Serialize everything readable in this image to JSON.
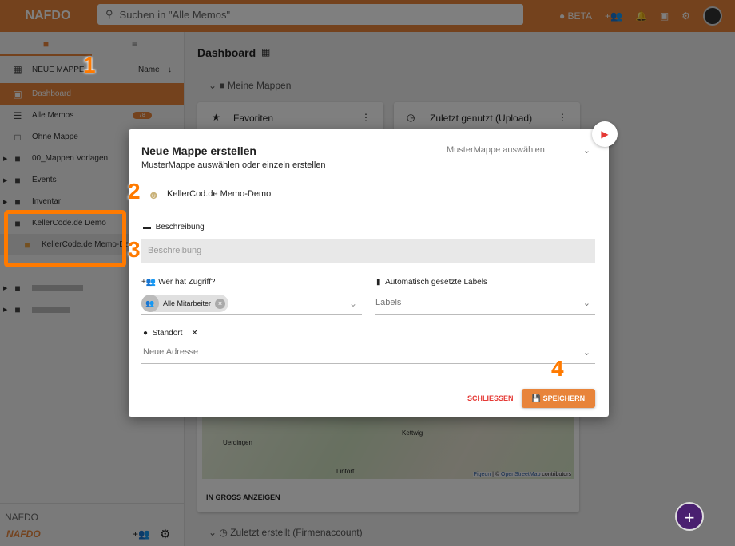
{
  "header": {
    "logo": "NAFDO",
    "search_placeholder": "Suchen in \"Alle Memos\"",
    "beta": "BETA"
  },
  "sidebar": {
    "new_folder": "NEUE MAPPE",
    "sort": "Name",
    "items": [
      {
        "label": "Dashboard"
      },
      {
        "label": "Alle Memos",
        "badge": "78"
      },
      {
        "label": "Ohne Mappe"
      },
      {
        "label": "00_Mappen Vorlagen"
      },
      {
        "label": "Events"
      },
      {
        "label": "Inventar"
      },
      {
        "label": "KellerCode.de Demo"
      },
      {
        "label": "KellerCode.de Memo-Demo"
      }
    ],
    "footer": "NAFDO",
    "footer_logo": "NAFDO"
  },
  "main": {
    "title": "Dashboard",
    "section": "Meine Mappen",
    "card1": "Favoriten",
    "card2": "Zuletzt genutzt (Upload)",
    "map_attrib_pigeon": "Pigeon",
    "map_attrib_osm": "OpenStreetMap",
    "map_attrib_rest": "contributors",
    "map_labels": [
      "Uerdingen",
      "Kettwig",
      "Lintorf"
    ],
    "show_large": "IN GROSS ANZEIGEN",
    "section2": "Zuletzt erstellt (Firmenaccount)"
  },
  "modal": {
    "title": "Neue Mappe erstellen",
    "subtitle": "MusterMappe auswählen oder einzeln erstellen",
    "template_select": "MusterMappe auswählen",
    "name_value": "KellerCod.de Memo-Demo",
    "desc_label": "Beschreibung",
    "desc_placeholder": "Beschreibung",
    "access_label": "Wer hat Zugriff?",
    "access_chip": "Alle Mitarbeiter",
    "labels_label": "Automatisch gesetzte Labels",
    "labels_placeholder": "Labels",
    "location_label": "Standort",
    "address_placeholder": "Neue Adresse",
    "close": "SCHLIESSEN",
    "save": "SPEICHERN"
  },
  "annotations": [
    "1",
    "2",
    "3",
    "4"
  ],
  "colors": {
    "accent": "#e8843a",
    "fab": "#4a2070",
    "close": "#e53935"
  }
}
